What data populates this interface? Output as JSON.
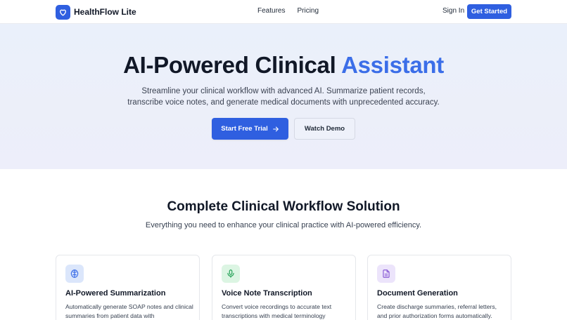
{
  "nav": {
    "brand": "HealthFlow Lite",
    "links": [
      "Features",
      "Pricing"
    ],
    "signin": "Sign In",
    "cta": "Get Started"
  },
  "hero": {
    "title_main": "AI-Powered Clinical ",
    "title_accent": "Assistant",
    "subtitle_line1": "Streamline your clinical workflow with advanced AI. Summarize patient records,",
    "subtitle_line2": "transcribe voice notes, and generate medical documents with unprecedented accuracy.",
    "primary_button": "Start Free Trial",
    "secondary_button": "Watch Demo"
  },
  "features": {
    "title": "Complete Clinical Workflow Solution",
    "subtitle": "Everything you need to enhance your clinical practice with AI-powered efficiency.",
    "cards": [
      {
        "title": "AI-Powered Summarization",
        "desc": "Automatically generate SOAP notes and clinical summaries from patient data with",
        "icon": "brain-icon",
        "icon_bg": "#dbe6fb",
        "icon_color": "#3b6ee8"
      },
      {
        "title": "Voice Note Transcription",
        "desc": "Convert voice recordings to accurate text transcriptions with medical terminology",
        "icon": "microphone-icon",
        "icon_bg": "#dcf5e3",
        "icon_color": "#22a055"
      },
      {
        "title": "Document Generation",
        "desc": "Create discharge summaries, referral letters, and prior authorization forms automatically.",
        "icon": "document-icon",
        "icon_bg": "#ece4fb",
        "icon_color": "#8a5cd6"
      }
    ]
  },
  "colors": {
    "primary": "#2f5fe0",
    "accent_text": "#3b6ee8"
  }
}
